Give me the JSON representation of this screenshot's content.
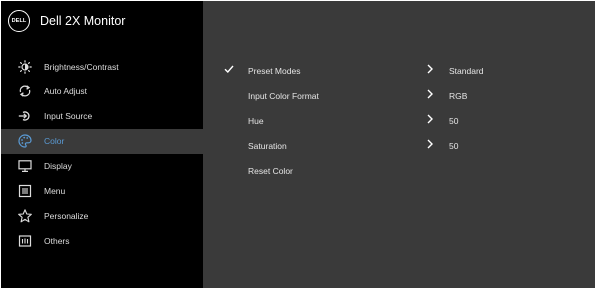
{
  "header": {
    "logo_text": "DELL",
    "title": "Dell 2X Monitor"
  },
  "sidebar": {
    "items": [
      {
        "label": "Brightness/Contrast",
        "icon": "brightness-icon"
      },
      {
        "label": "Auto Adjust",
        "icon": "auto-adjust-icon"
      },
      {
        "label": "Input Source",
        "icon": "input-source-icon"
      },
      {
        "label": "Color",
        "icon": "color-palette-icon",
        "active": true
      },
      {
        "label": "Display",
        "icon": "display-icon"
      },
      {
        "label": "Menu",
        "icon": "menu-icon"
      },
      {
        "label": "Personalize",
        "icon": "star-icon"
      },
      {
        "label": "Others",
        "icon": "others-icon"
      }
    ]
  },
  "color_settings": {
    "rows": [
      {
        "label": "Preset Modes",
        "value": "Standard",
        "selected": true
      },
      {
        "label": "Input Color Format",
        "value": "RGB"
      },
      {
        "label": "Hue",
        "value": "50"
      },
      {
        "label": "Saturation",
        "value": "50"
      },
      {
        "label": "Reset Color",
        "value": ""
      }
    ]
  },
  "colors": {
    "active_accent": "#5b9bd5",
    "sidebar_bg": "#000000",
    "panel_bg": "#3a3a3a"
  }
}
